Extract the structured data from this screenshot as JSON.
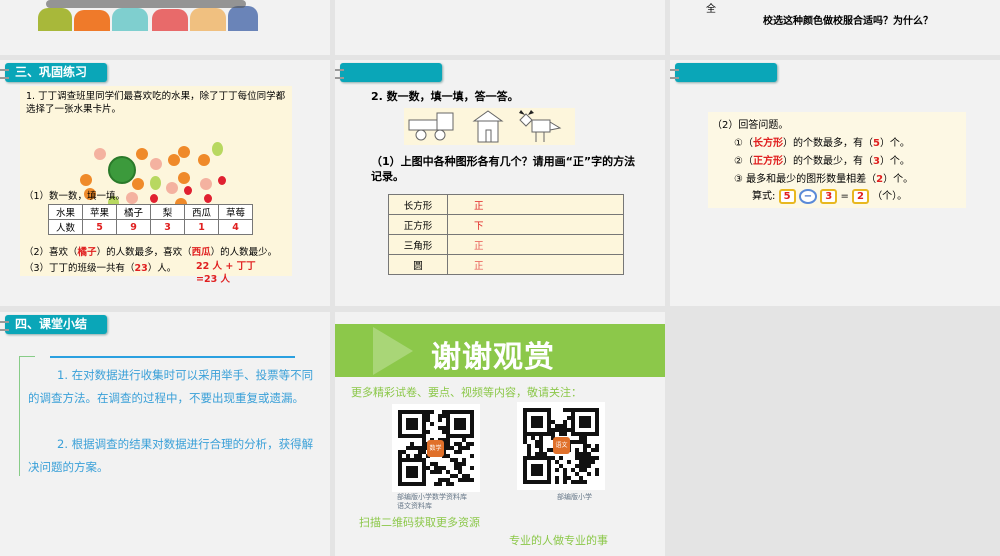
{
  "slides": {
    "top_right": {
      "line1": "全",
      "line2": "校选这种颜色做校服合适吗？为什么？"
    },
    "s1": {
      "header": "三、巩固练习",
      "question": "1. 丁丁调查班里同学们最喜欢吃的水果，除了丁丁每位同学都选择了一张水果卡片。",
      "part1": "（1）数一数，填一填。",
      "table": {
        "headers": [
          "水果",
          "苹果",
          "橘子",
          "梨",
          "西瓜",
          "草莓"
        ],
        "row_label": "人数",
        "values": [
          "5",
          "9",
          "3",
          "1",
          "4"
        ]
      },
      "part2": {
        "a": "（2）喜欢（",
        "most": "橘子",
        "b": "）的人数最多，喜欢（",
        "least": "西瓜",
        "c": "）的人数最少。"
      },
      "part3": {
        "a": "（3）丁丁的班级一共有（",
        "total": "23",
        "b": "）人。",
        "note": "22 人 + 丁丁 =23 人"
      }
    },
    "s2": {
      "header": "",
      "question": "2. 数一数，填一填，答一答。",
      "part1": "（1）上图中各种图形各有几个？请用画“正”字的方法记录。",
      "rows": [
        {
          "shape": "长方形",
          "tally": "正"
        },
        {
          "shape": "正方形",
          "tally": "下"
        },
        {
          "shape": "三角形",
          "tally": "正"
        },
        {
          "shape": "圆",
          "tally": "正"
        }
      ]
    },
    "s3": {
      "header": "",
      "title": "（2）回答问题。",
      "q1": {
        "a": "①（",
        "ans": "长方形",
        "b": "）的个数最多，有（",
        "n": "5",
        "c": "）个。"
      },
      "q2": {
        "a": "②（",
        "ans": "正方形",
        "b": "）的个数最少，有（",
        "n": "3",
        "c": "）个。"
      },
      "q3": {
        "a": "③ 最多和最少的图形数量相差（",
        "n": "2",
        "c": "）个。"
      },
      "formula": {
        "label": "算式:",
        "a": "5",
        "op": "−",
        "b": "3",
        "eq": "=",
        "r": "2",
        "unit": "（个）。"
      }
    },
    "s4": {
      "header": "四、课堂小结",
      "p1": "1. 在对数据进行收集时可以采用举手、投票等不同的调查方法。在调查的过程中，不要出现重复或遗漏。",
      "p2": "2. 根据调查的结果对数据进行合理的分析，获得解决问题的方案。"
    },
    "s5": {
      "title": "谢谢观赏",
      "subtitle": "更多精彩试卷、要点、视频等内容，敬请关注：",
      "qr1_label": "部编版小学数学资料库",
      "qr1_label2": "语文资料库",
      "qr2_label": "部编版小学",
      "qr1_badge": "数学",
      "qr2_badge": "语文",
      "scan": "扫描二维码获取更多资源",
      "slogan": "专业的人做专业的事"
    }
  }
}
